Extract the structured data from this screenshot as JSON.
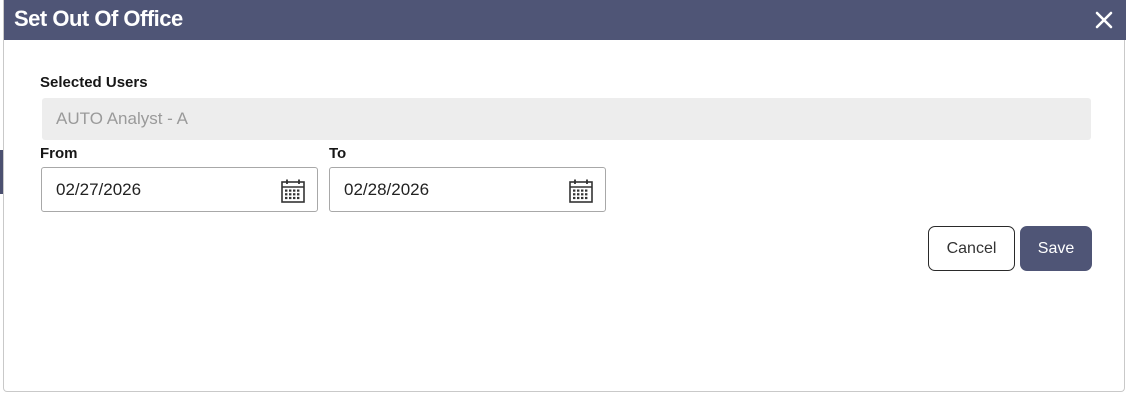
{
  "dialog": {
    "title": "Set Out Of Office",
    "close_icon": "close-icon"
  },
  "selected_users": {
    "label": "Selected Users",
    "value": "AUTO Analyst - A"
  },
  "from": {
    "label": "From",
    "value": "02/27/2026",
    "icon": "calendar-icon"
  },
  "to": {
    "label": "To",
    "value": "02/28/2026",
    "icon": "calendar-icon"
  },
  "actions": {
    "cancel_label": "Cancel",
    "save_label": "Save"
  },
  "colors": {
    "header": "#4f5576",
    "save_button": "#4f5576",
    "readonly_background": "#ededed"
  }
}
